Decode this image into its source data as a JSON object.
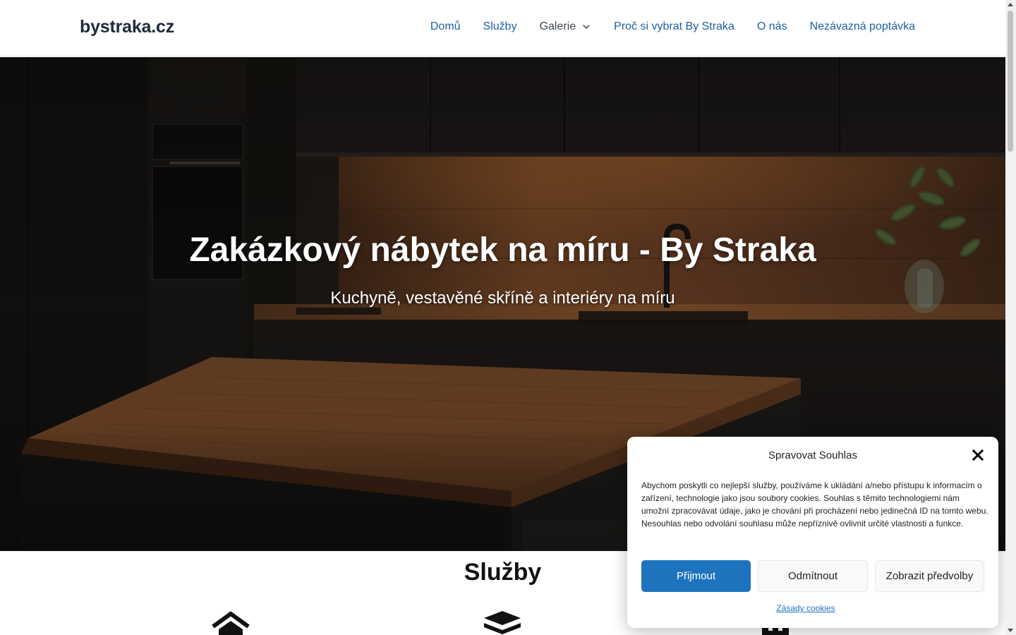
{
  "header": {
    "logo": "bystraka.cz",
    "nav": [
      {
        "label": "Domů"
      },
      {
        "label": "Služby"
      },
      {
        "label": "Galerie"
      },
      {
        "label": "Proč si vybrat By Straka"
      },
      {
        "label": "O nás"
      },
      {
        "label": "Nezávazná poptávka"
      }
    ]
  },
  "hero": {
    "title": "Zakázkový nábytek na míru - By Straka",
    "subtitle": "Kuchyně, vestavěné skříně a interiéry na míru"
  },
  "services": {
    "heading": "Služby",
    "icons": [
      "house-icon",
      "layers-icon",
      "building-icon"
    ]
  },
  "cookie_dialog": {
    "title": "Spravovat Souhlas",
    "text": "Abychom poskytli co nejlepší služby, používáme k ukládání a/nebo přístupu k informacím o zařízení, technologie jako jsou soubory cookies. Souhlas s těmito technologiemi nám umožní zpracovávat údaje, jako je chování při procházení nebo jedinečná ID na tomto webu. Nesouhlas nebo odvolání souhlasu může nepříznivě ovlivnit určité vlastnosti a funkce.",
    "accept_label": "Přijmout",
    "deny_label": "Odmítnout",
    "prefs_label": "Zobrazit předvolby",
    "policy_link": "Zásady cookies"
  },
  "colors": {
    "nav_link": "#1e5fa6",
    "accept_button": "#1e73be",
    "logo": "#1e293b"
  }
}
